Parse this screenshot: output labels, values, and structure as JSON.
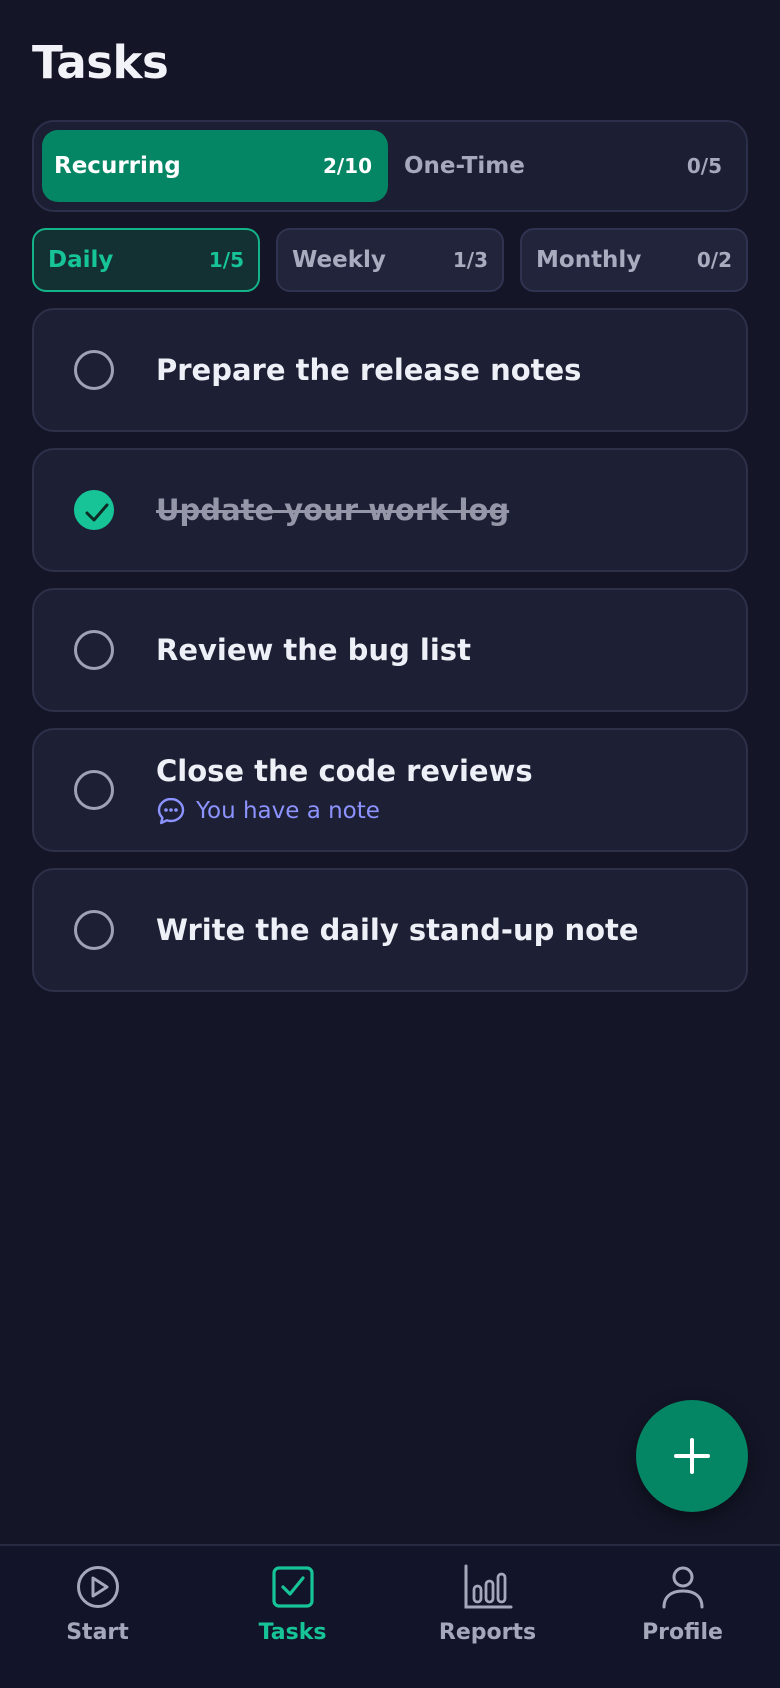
{
  "header": {
    "title": "Tasks"
  },
  "segment": {
    "recurring": {
      "label": "Recurring",
      "count": "2/10"
    },
    "one_time": {
      "label": "One-Time",
      "count": "0/5"
    }
  },
  "filters": [
    {
      "label": "Daily",
      "count": "1/5"
    },
    {
      "label": "Weekly",
      "count": "1/3"
    },
    {
      "label": "Monthly",
      "count": "0/2"
    }
  ],
  "tasks": [
    {
      "title": "Prepare the release notes",
      "done": false
    },
    {
      "title": "Update your work log",
      "done": true
    },
    {
      "title": "Review the bug list",
      "done": false
    },
    {
      "title": "Close the code reviews",
      "done": false,
      "note": "You have a note"
    },
    {
      "title": "Write the daily stand-up note",
      "done": false
    }
  ],
  "nav": [
    {
      "label": "Start",
      "icon": "play-circle-icon"
    },
    {
      "label": "Tasks",
      "icon": "checkbox-icon"
    },
    {
      "label": "Reports",
      "icon": "bar-chart-icon"
    },
    {
      "label": "Profile",
      "icon": "user-icon"
    }
  ],
  "colors": {
    "background": "#141628",
    "accent": "#048563",
    "accent_bright": "#17c497",
    "note": "#8c93ff"
  }
}
